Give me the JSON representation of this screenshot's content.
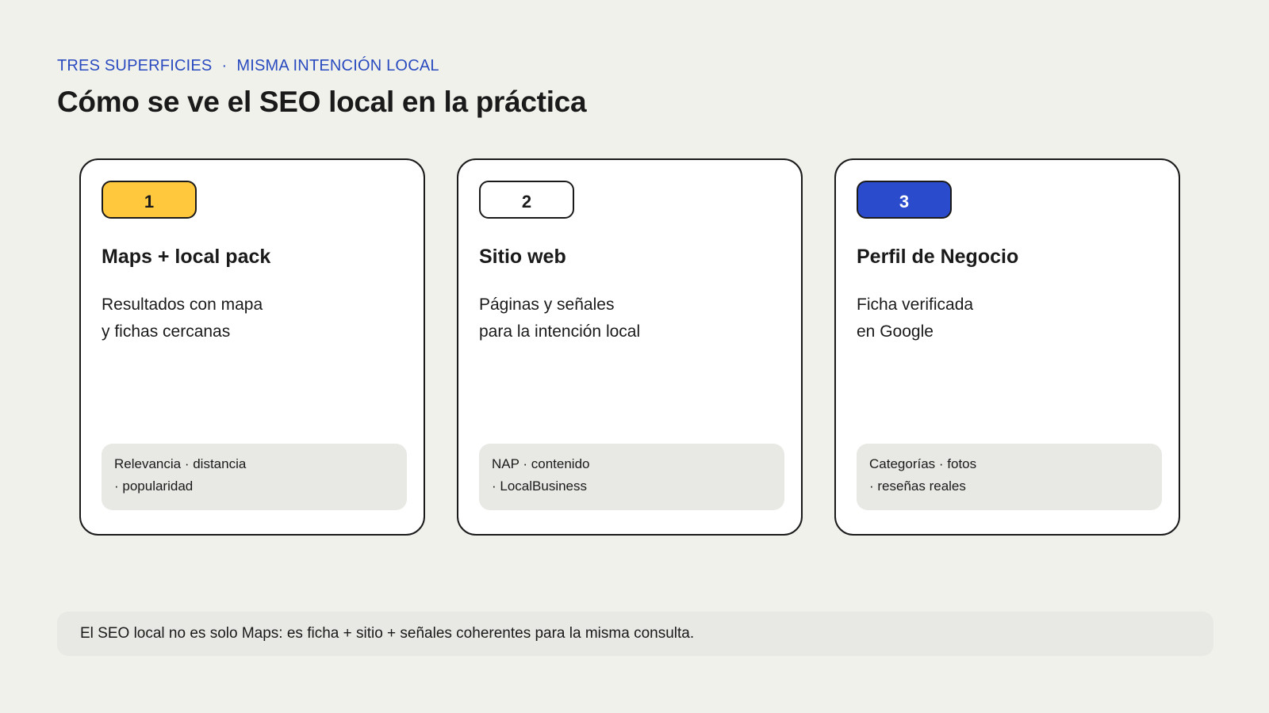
{
  "header": {
    "eyebrow_left": "TRES SUPERFICIES",
    "eyebrow_sep": "·",
    "eyebrow_right": "MISMA INTENCIÓN LOCAL",
    "title": "Cómo se ve el SEO local en la práctica"
  },
  "cards": [
    {
      "number": "1",
      "badge_color": "#ffc83d",
      "badge_text_color": "#1a1a1a",
      "title": "Maps + local pack",
      "desc_line1": "Resultados con mapa",
      "desc_line2": "y fichas cercanas",
      "foot_line1": "Relevancia · distancia",
      "foot_line2": "· popularidad"
    },
    {
      "number": "2",
      "badge_color": "#ffffff",
      "badge_text_color": "#1a1a1a",
      "title": "Sitio web",
      "desc_line1": "Páginas y señales",
      "desc_line2": "para la intención local",
      "foot_line1": "NAP · contenido",
      "foot_line2": "· LocalBusiness"
    },
    {
      "number": "3",
      "badge_color": "#2a4bcc",
      "badge_text_color": "#ffffff",
      "title": "Perfil de Negocio",
      "desc_line1": "Ficha verificada",
      "desc_line2": "en Google",
      "foot_line1": "Categorías · fotos",
      "foot_line2": "· reseñas reales"
    }
  ],
  "note": {
    "text": "El SEO local no es solo Maps: es ficha + sitio + señales coherentes para la misma consulta."
  }
}
